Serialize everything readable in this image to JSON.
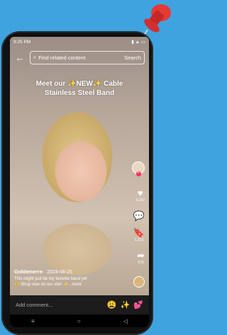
{
  "status": {
    "time": "9:25 PM",
    "icons": "signal wifi battery"
  },
  "search": {
    "placeholder": "Find related content",
    "button": "Search"
  },
  "video": {
    "headline": "Meet our ✨NEW✨ Cable Stainless Steel Band"
  },
  "rail": {
    "likes": "5,197",
    "comments": "",
    "saves": "1,213",
    "shares": "579"
  },
  "post": {
    "author": "Goldenerre",
    "date": "2024-06-25",
    "desc_line1": "This might just be my favorite band yet",
    "desc_line2": "🫶 Shop now on our site! ✨...more"
  },
  "comment": {
    "placeholder": "Add comment...",
    "emojis": [
      "😩",
      "✨",
      "💕"
    ]
  },
  "nav": {
    "menu": "≡",
    "home": "○",
    "back": "◁"
  },
  "colors": {
    "accent": "#fe2c55",
    "background": "#3fa3e0"
  }
}
